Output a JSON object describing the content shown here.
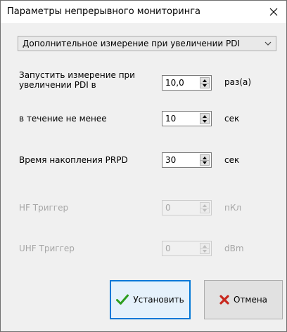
{
  "dialog": {
    "title": "Параметры непрерывного мониторинга"
  },
  "dropdown": {
    "selected": "Дополнительное измерение при увеличении PDI"
  },
  "fields": {
    "pdi_increase": {
      "label_line1": "Запустить измерение при",
      "label_line2": "увеличении PDI в",
      "value": "10,0",
      "unit": "раз(а)"
    },
    "duration": {
      "label": "в течение не менее",
      "value": "10",
      "unit": "сек"
    },
    "prpd_time": {
      "label": "Время накопления PRPD",
      "value": "30",
      "unit": "сек"
    },
    "hf_trigger": {
      "label": "HF  Триггер",
      "value": "0",
      "unit": "пКл",
      "enabled": false
    },
    "uhf_trigger": {
      "label": "UHF Триггер",
      "value": "0",
      "unit": "dBm",
      "enabled": false
    }
  },
  "buttons": {
    "set_label": "Установить",
    "cancel_label": "Отмена"
  },
  "icons": {
    "close": "close-icon",
    "dropdown": "chevron-down-icon",
    "set": "checkmark-icon",
    "cancel": "red-x-icon"
  },
  "colors": {
    "accent": "#0078d7",
    "check": "#2e9e1f",
    "cancel": "#c8281e",
    "disabled_text": "#a6a6a6"
  }
}
